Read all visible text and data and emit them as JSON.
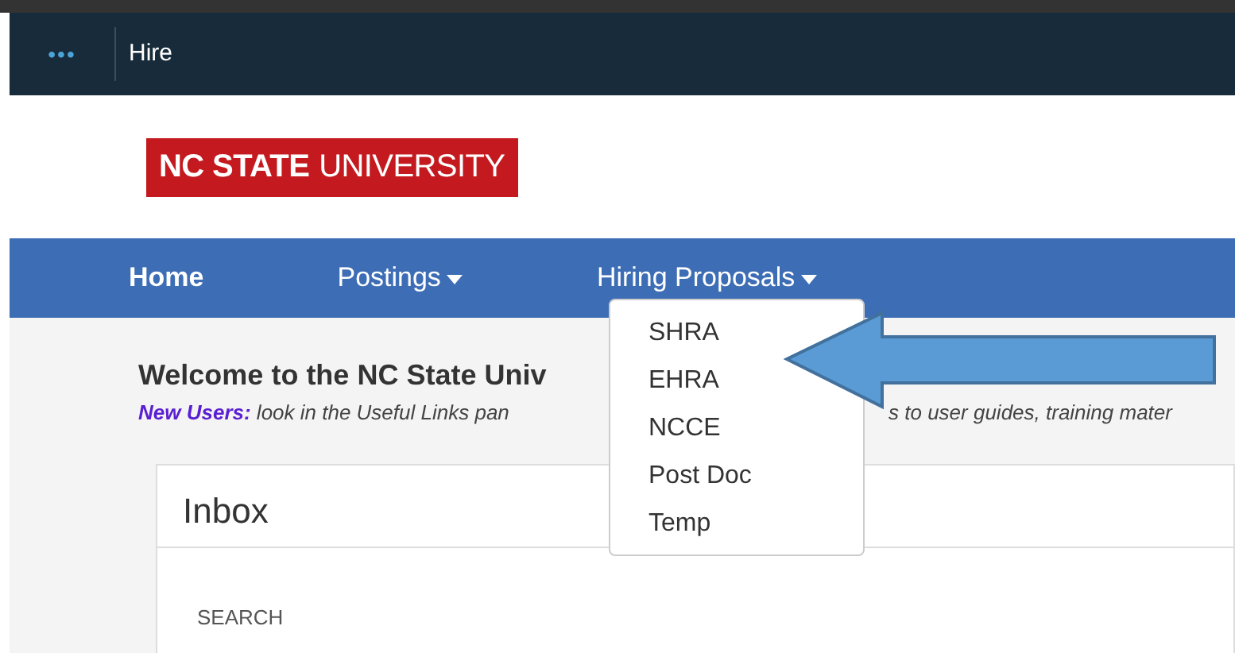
{
  "app_bar": {
    "menu_icon": "•••",
    "title": "Hire"
  },
  "logo": {
    "bold": "NC STATE",
    "light": "UNIVERSITY"
  },
  "nav": [
    {
      "label": "Home",
      "selected": true,
      "dropdown": false
    },
    {
      "label": "Postings",
      "selected": false,
      "dropdown": true
    },
    {
      "label": "Hiring Proposals",
      "selected": false,
      "dropdown": true
    }
  ],
  "dropdown_menu": [
    "SHRA",
    "EHRA",
    "NCCE",
    "Post Doc",
    "Temp"
  ],
  "welcome": {
    "heading": "Welcome to the NC State Univ",
    "lead": "New Users:",
    "text_parts": [
      "look in the Useful Links pan",
      "s to user guides, training mater"
    ]
  },
  "inbox": {
    "title": "Inbox",
    "search_label": "SEARCH"
  }
}
